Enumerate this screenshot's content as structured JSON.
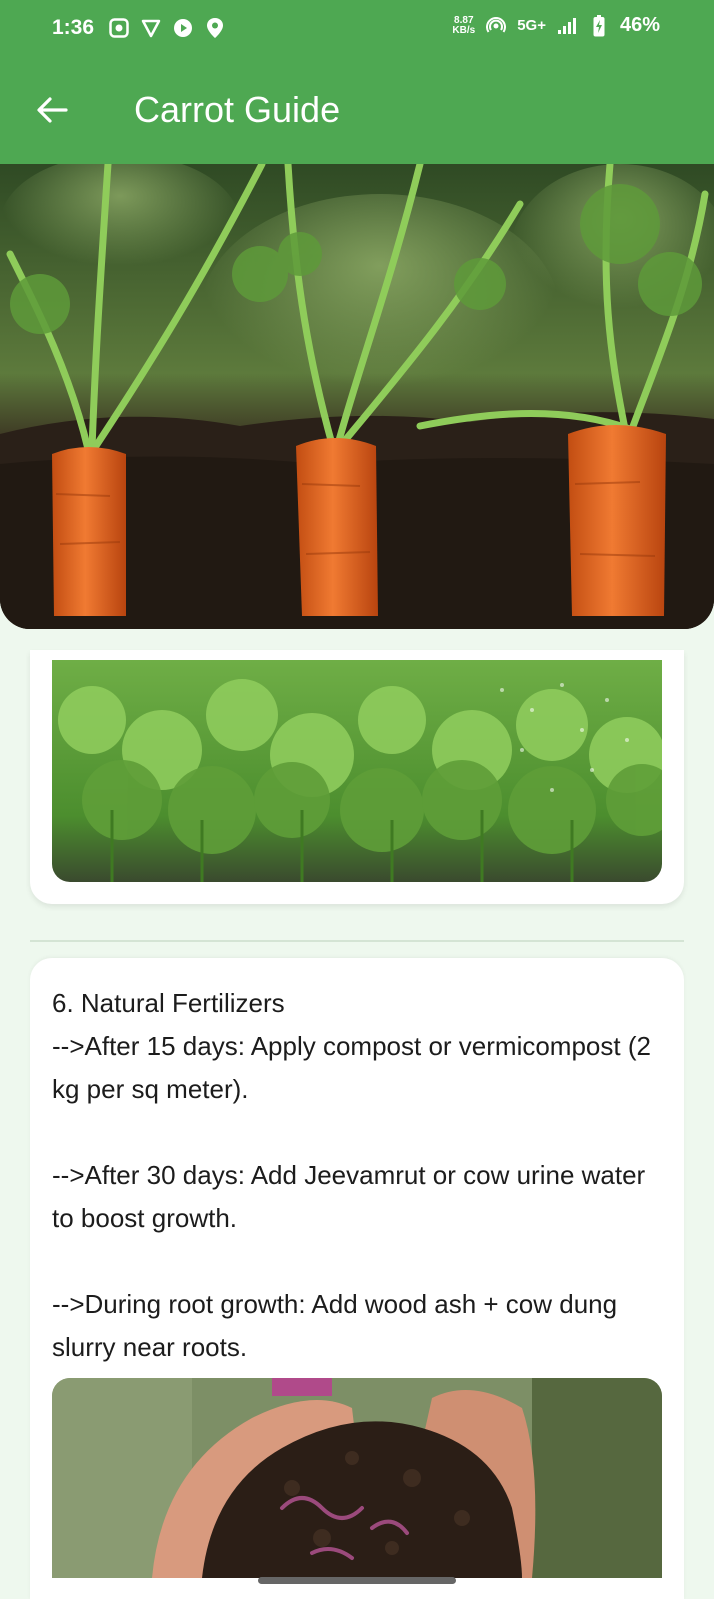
{
  "status_bar": {
    "time": "1:36",
    "net_speed_value": "8.87",
    "net_speed_unit": "KB/s",
    "network_type": "5G+",
    "battery": "46%"
  },
  "app_bar": {
    "title": "Carrot Guide",
    "back_icon": "arrow-left-icon"
  },
  "section6": {
    "lines": [
      "6. Natural Fertilizers",
      "-->After 15 days: Apply compost or vermicompost (2 kg per sq meter).",
      "",
      "-->After 30 days: Add Jeevamrut or cow urine water to boost growth.",
      "",
      "-->During root growth: Add wood ash + cow dung slurry near roots."
    ]
  },
  "colors": {
    "app_bar": "#4ea852",
    "background": "#eef8ee",
    "card": "#ffffff"
  }
}
